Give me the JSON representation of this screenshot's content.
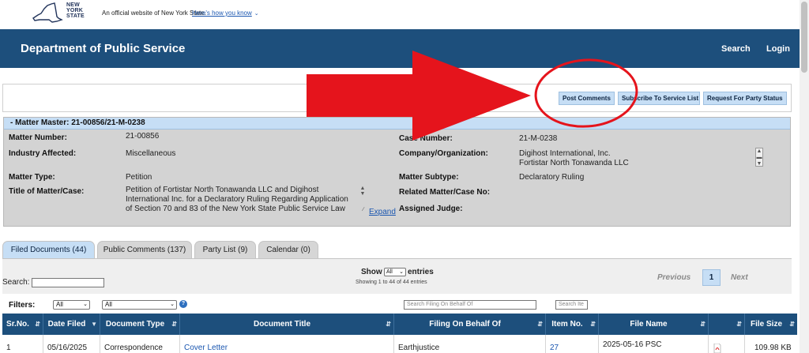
{
  "gov_banner": {
    "logo_words": [
      "NEW",
      "YORK",
      "STATE"
    ],
    "official_text": "An official website of New York State.",
    "how_link": "Here's how you know"
  },
  "header": {
    "title": "Department of Public Service",
    "search_label": "Search",
    "login_label": "Login"
  },
  "actions": {
    "post_comments": "Post Comments",
    "subscribe": "Subscribe To Service List",
    "request_party": "Request For Party Status"
  },
  "matter": {
    "heading": "-  Matter Master: 21-00856/21-M-0238",
    "matter_number_label": "Matter Number:",
    "matter_number": "21-00856",
    "industry_label": "Industry Affected:",
    "industry": "Miscellaneous",
    "matter_type_label": "Matter Type:",
    "matter_type": "Petition",
    "title_label": "Title of Matter/Case:",
    "title_lines": [
      "Petition of Fortistar North Tonawanda LLC and Digihost",
      "International Inc. for a Declaratory Ruling Regarding Application",
      "of Section 70 and 83 of the New York State Public Service Law"
    ],
    "expand_label": "Expand",
    "case_number_label": "Case Number:",
    "case_number": "21-M-0238",
    "company_label": "Company/Organization:",
    "company_lines": [
      "Digihost International, Inc.",
      "Fortistar North Tonawanda LLC"
    ],
    "subtype_label": "Matter Subtype:",
    "subtype": "Declaratory Ruling",
    "related_label": "Related Matter/Case No:",
    "related": "",
    "judge_label": "Assigned Judge:",
    "judge": ""
  },
  "tabs": [
    {
      "label": "Filed Documents (44)",
      "active": true
    },
    {
      "label": "Public Comments (137)",
      "active": false
    },
    {
      "label": "Party List (9)",
      "active": false
    },
    {
      "label": "Calendar (0)",
      "active": false
    }
  ],
  "table_controls": {
    "search_label": "Search:",
    "show_label": "Show",
    "show_value": "All",
    "entries_label": "entries",
    "showing_text": "Showing 1 to 44 of 44 entries",
    "previous": "Previous",
    "page": "1",
    "next": "Next"
  },
  "filters": {
    "label": "Filters:",
    "filter1_value": "All",
    "filter2_value": "All",
    "help_icon": "?",
    "filing_placeholder": "Search Filing On Behalf Of",
    "item_placeholder": "Search Ite"
  },
  "columns": [
    "Sr.No.",
    "Date Filed",
    "Document Type",
    "Document Title",
    "Filing On Behalf Of",
    "Item No.",
    "File Name",
    "",
    "File Size"
  ],
  "rows": [
    {
      "sr": "1",
      "date": "05/16/2025",
      "type": "Correspondence",
      "title": "Cover Letter",
      "filing": "Earthjustice",
      "item": "27",
      "file_name": "2025-05-16 PSC",
      "size": "109.98 KB"
    }
  ],
  "colors": {
    "header_bg": "#1d4f7c",
    "button_bg": "#c6def5",
    "panel_bg": "#d3d3d3",
    "annotation_red": "#e5141c"
  }
}
